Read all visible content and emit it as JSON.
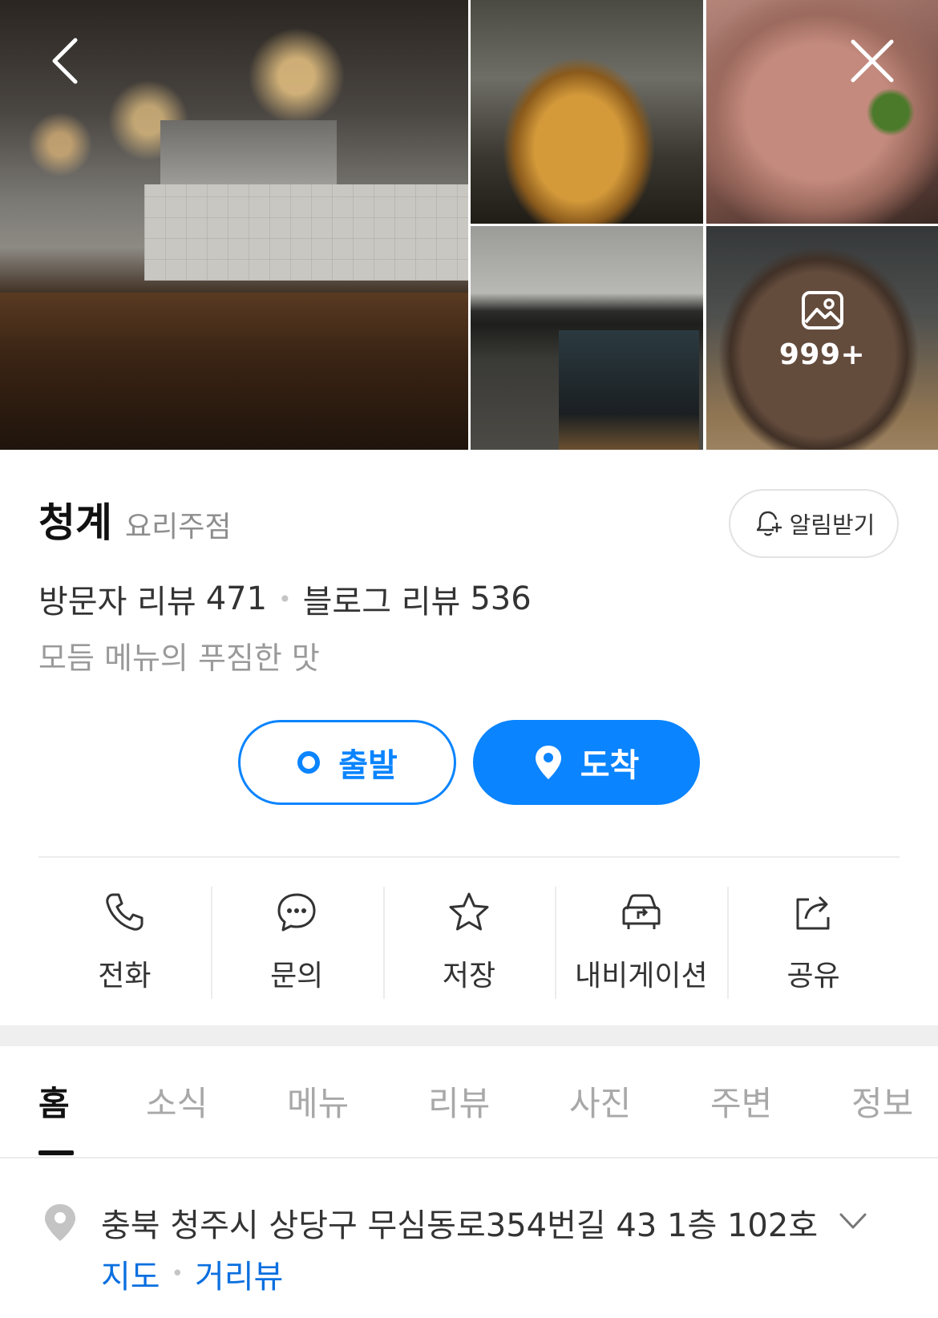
{
  "gallery": {
    "photo_count_label": "999+"
  },
  "place": {
    "name": "청계",
    "category": "요리주점",
    "alert_label": "알림받기"
  },
  "reviews": {
    "visitor_label": "방문자 리뷰",
    "visitor_count": "471",
    "blog_label": "블로그 리뷰",
    "blog_count": "536"
  },
  "tagline": "모듬 메뉴의 푸짐한 맛",
  "route": {
    "depart_label": "출발",
    "arrive_label": "도착"
  },
  "actions": [
    {
      "label": "전화",
      "icon": "phone-icon"
    },
    {
      "label": "문의",
      "icon": "chat-icon"
    },
    {
      "label": "저장",
      "icon": "star-icon"
    },
    {
      "label": "내비게이션",
      "icon": "navigation-car-icon"
    },
    {
      "label": "공유",
      "icon": "share-icon"
    }
  ],
  "tabs": [
    {
      "label": "홈",
      "active": true
    },
    {
      "label": "소식"
    },
    {
      "label": "메뉴"
    },
    {
      "label": "리뷰"
    },
    {
      "label": "사진"
    },
    {
      "label": "주변"
    },
    {
      "label": "정보"
    }
  ],
  "address": {
    "text": "충북 청주시 상당구 무심동로354번길 43 1층 102호",
    "map_link": "지도",
    "street_view_link": "거리뷰"
  },
  "colors": {
    "accent": "#0a84ff",
    "link": "#0a6fe0"
  }
}
